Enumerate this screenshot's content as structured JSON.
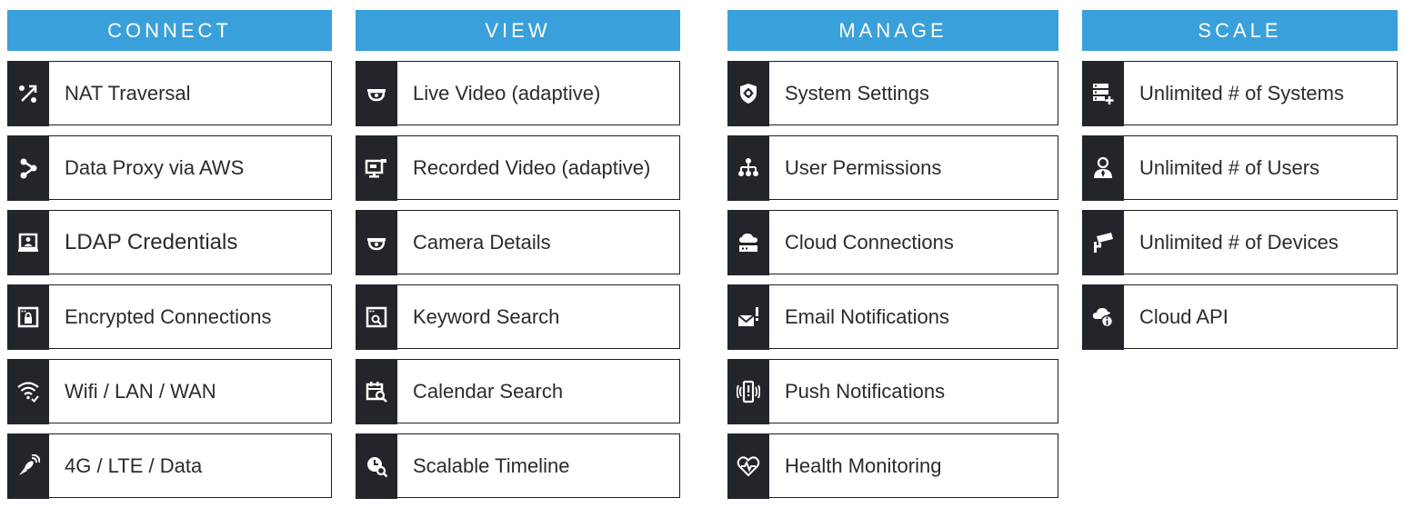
{
  "colors": {
    "header_bg": "#3aa0db",
    "header_text": "#ffffff",
    "icon_strip_bg": "#22262b",
    "border": "#1e1e1e",
    "label_text": "#2b2b2b"
  },
  "columns": [
    {
      "title": "CONNECT",
      "items": [
        {
          "label": "NAT Traversal",
          "icon": "nat-traversal-icon"
        },
        {
          "label": "Data Proxy via AWS",
          "icon": "proxy-icon"
        },
        {
          "label": "LDAP Credentials",
          "icon": "ldap-user-icon"
        },
        {
          "label": "Encrypted Connections",
          "icon": "lock-window-icon"
        },
        {
          "label": "Wifi / LAN / WAN",
          "icon": "wifi-check-icon"
        },
        {
          "label": "4G / LTE / Data",
          "icon": "satellite-icon"
        }
      ]
    },
    {
      "title": "VIEW",
      "items": [
        {
          "label": "Live Video (adaptive)",
          "icon": "dome-camera-icon"
        },
        {
          "label": "Recorded Video (adaptive)",
          "icon": "monitor-camera-icon"
        },
        {
          "label": "Camera Details",
          "icon": "dome-camera-icon"
        },
        {
          "label": "Keyword Search",
          "icon": "search-window-icon"
        },
        {
          "label": "Calendar Search",
          "icon": "calendar-search-icon"
        },
        {
          "label": "Scalable Timeline",
          "icon": "clock-search-icon"
        }
      ]
    },
    {
      "title": "MANAGE",
      "items": [
        {
          "label": "System Settings",
          "icon": "shield-gear-icon"
        },
        {
          "label": "User Permissions",
          "icon": "hierarchy-icon"
        },
        {
          "label": "Cloud Connections",
          "icon": "cloud-server-icon"
        },
        {
          "label": "Email Notifications",
          "icon": "email-alert-icon"
        },
        {
          "label": "Push Notifications",
          "icon": "phone-alert-icon"
        },
        {
          "label": "Health Monitoring",
          "icon": "heart-pulse-icon"
        }
      ]
    },
    {
      "title": "SCALE",
      "items": [
        {
          "label": "Unlimited # of Systems",
          "icon": "server-plus-icon"
        },
        {
          "label": "Unlimited # of Users",
          "icon": "user-tie-icon"
        },
        {
          "label": "Unlimited # of Devices",
          "icon": "bullet-camera-icon"
        },
        {
          "label": "Cloud API",
          "icon": "cloud-info-icon"
        }
      ]
    }
  ]
}
